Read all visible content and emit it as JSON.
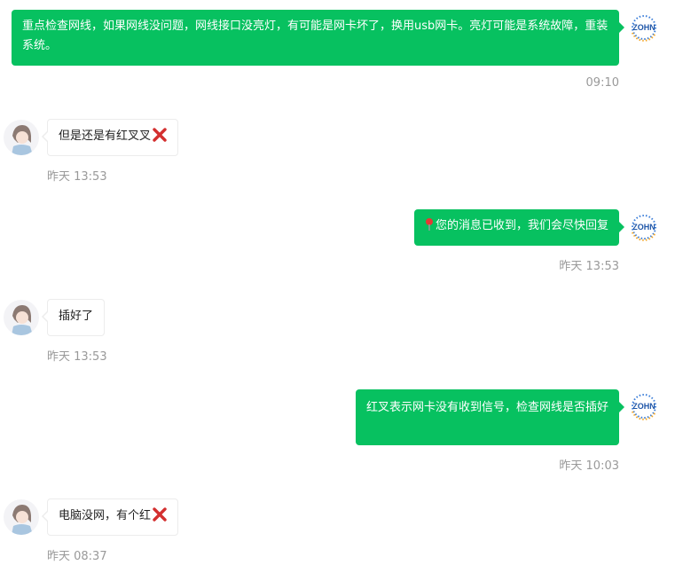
{
  "messages": [
    {
      "sender": "agent",
      "text": "重点检查网线，如果网线没问题，网线接口没亮灯，有可能是网卡坏了，换用usb网卡。亮灯可能是系统故障，重装系统。",
      "time": "09:10"
    },
    {
      "sender": "user",
      "text": "但是还是有红叉叉",
      "emoji": "cross-mark",
      "time": "昨天 13:53"
    },
    {
      "sender": "agent",
      "text": "您的消息已收到，我们会尽快回复",
      "emoji": "pin",
      "time": "昨天 13:53"
    },
    {
      "sender": "user",
      "text": "插好了",
      "time": "昨天 13:53"
    },
    {
      "sender": "agent",
      "text": "红叉表示网卡没有收到信号，检查网线是否插好",
      "time": "昨天 10:03"
    },
    {
      "sender": "user",
      "text": "电脑没网，有个红",
      "emoji": "cross-mark",
      "time": "昨天 08:37"
    }
  ],
  "agent_avatar": {
    "logo_text": "ZOHN"
  },
  "colors": {
    "outgoing_bubble": "#07c160",
    "timestamp": "#999999",
    "cross": "#d32f2f"
  }
}
